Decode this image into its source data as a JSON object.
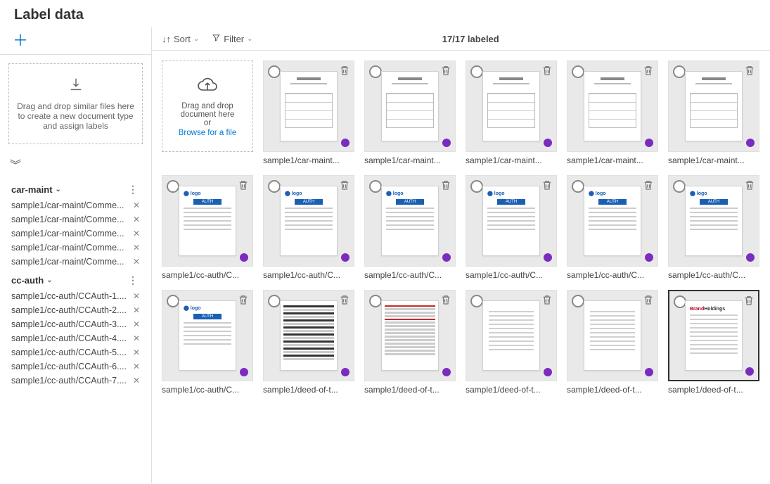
{
  "pageTitle": "Label data",
  "sidebar": {
    "dropTarget": "Drag and drop similar files here to create a new document type and assign labels",
    "groups": [
      {
        "name": "car-maint",
        "files": [
          "sample1/car-maint/Comme...",
          "sample1/car-maint/Comme...",
          "sample1/car-maint/Comme...",
          "sample1/car-maint/Comme...",
          "sample1/car-maint/Comme..."
        ]
      },
      {
        "name": "cc-auth",
        "files": [
          "sample1/cc-auth/CCAuth-1....",
          "sample1/cc-auth/CCAuth-2....",
          "sample1/cc-auth/CCAuth-3....",
          "sample1/cc-auth/CCAuth-4....",
          "sample1/cc-auth/CCAuth-5....",
          "sample1/cc-auth/CCAuth-6....",
          "sample1/cc-auth/CCAuth-7...."
        ]
      }
    ]
  },
  "toolbar": {
    "sort": "Sort",
    "filter": "Filter",
    "counter": "17/17 labeled"
  },
  "dropMain": {
    "line1": "Drag and drop document here",
    "line2": "or",
    "browse": "Browse for a file"
  },
  "cards": [
    {
      "caption": "sample1/car-maint...",
      "variant": "invoice",
      "selected": false
    },
    {
      "caption": "sample1/car-maint...",
      "variant": "invoice",
      "selected": false
    },
    {
      "caption": "sample1/car-maint...",
      "variant": "invoice",
      "selected": false
    },
    {
      "caption": "sample1/car-maint...",
      "variant": "invoice",
      "selected": false
    },
    {
      "caption": "sample1/car-maint...",
      "variant": "invoice",
      "selected": false
    },
    {
      "caption": "sample1/cc-auth/C...",
      "variant": "form",
      "selected": false
    },
    {
      "caption": "sample1/cc-auth/C...",
      "variant": "form",
      "selected": false
    },
    {
      "caption": "sample1/cc-auth/C...",
      "variant": "form",
      "selected": false
    },
    {
      "caption": "sample1/cc-auth/C...",
      "variant": "form",
      "selected": false
    },
    {
      "caption": "sample1/cc-auth/C...",
      "variant": "form",
      "selected": false
    },
    {
      "caption": "sample1/cc-auth/C...",
      "variant": "form",
      "selected": false
    },
    {
      "caption": "sample1/cc-auth/C...",
      "variant": "form",
      "selected": false
    },
    {
      "caption": "sample1/deed-of-t...",
      "variant": "dense-bk",
      "selected": false
    },
    {
      "caption": "sample1/deed-of-t...",
      "variant": "dense-rd",
      "selected": false
    },
    {
      "caption": "sample1/deed-of-t...",
      "variant": "sparse",
      "selected": false
    },
    {
      "caption": "sample1/deed-of-t...",
      "variant": "sparse",
      "selected": false
    },
    {
      "caption": "sample1/deed-of-t...",
      "variant": "brand",
      "selected": true
    }
  ]
}
